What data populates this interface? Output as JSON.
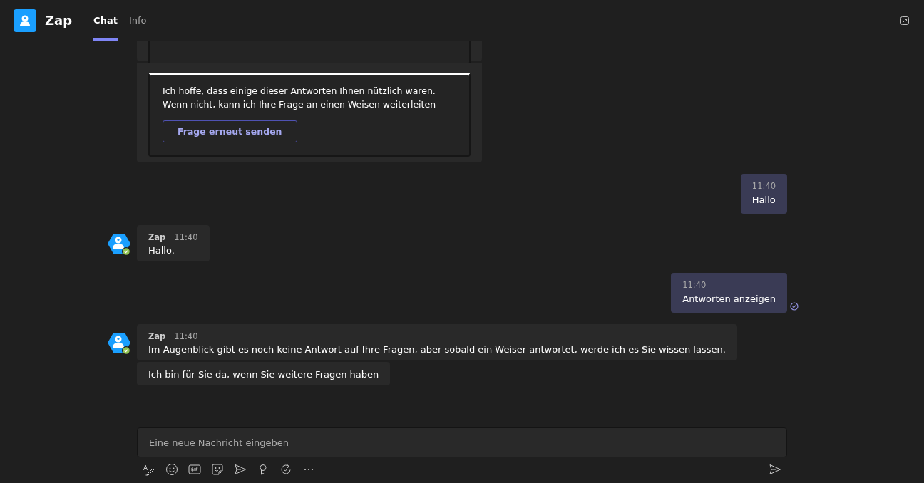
{
  "app": {
    "name": "Zap"
  },
  "tabs": [
    {
      "label": "Chat",
      "selected": true
    },
    {
      "label": "Info",
      "selected": false
    }
  ],
  "messages": [
    {
      "kind": "card_tail"
    },
    {
      "kind": "card",
      "text": "Ich hoffe, dass einige dieser Antworten Ihnen nützlich waren. Wenn nicht, kann ich Ihre Frage an einen Weisen weiterleiten",
      "button": "Frage erneut senden"
    },
    {
      "kind": "out",
      "time": "11:40",
      "text": "Hallo",
      "read": false
    },
    {
      "kind": "in",
      "sender": "Zap",
      "time": "11:40",
      "texts": [
        "Hallo."
      ]
    },
    {
      "kind": "out",
      "time": "11:40",
      "text": "Antworten anzeigen",
      "read": true
    },
    {
      "kind": "in",
      "sender": "Zap",
      "time": "11:40",
      "texts": [
        "Im Augenblick gibt es noch keine Antwort auf Ihre Fragen, aber sobald ein Weiser antwortet, werde ich es Sie wissen lassen.",
        "Ich bin für Sie da, wenn Sie weitere Fragen haben"
      ]
    }
  ],
  "composer": {
    "placeholder": "Eine neue Nachricht eingeben"
  }
}
